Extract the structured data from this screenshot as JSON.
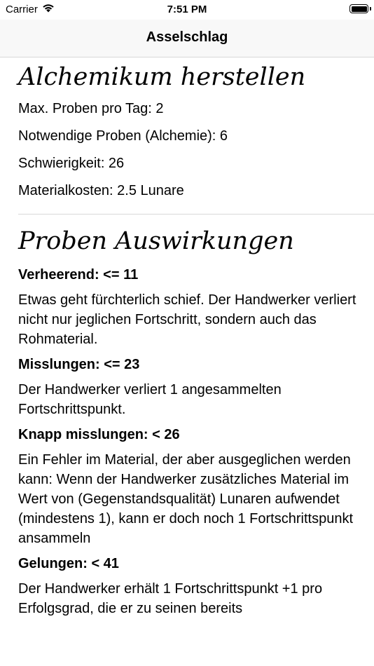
{
  "status_bar": {
    "carrier": "Carrier",
    "time": "7:51 PM"
  },
  "nav": {
    "title": "Asselschlag"
  },
  "crafting": {
    "title": "Alchemikum herstellen",
    "stats": [
      "Max. Proben pro Tag:  2",
      "Notwendige Proben (Alchemie):  6",
      "Schwierigkeit:  26",
      "Materialkosten:  2.5 Lunare"
    ]
  },
  "effects": {
    "title": "Proben Auswirkungen",
    "items": [
      {
        "heading": "Verheerend: <= 11",
        "text": "Etwas geht fürchterlich schief. Der Handwerker verliert nicht nur jeglichen Fortschritt, sondern auch das Rohmaterial."
      },
      {
        "heading": "Misslungen: <= 23",
        "text": "Der Handwerker verliert 1 angesammelten Fortschrittspunkt."
      },
      {
        "heading": "Knapp misslungen: < 26",
        "text": "Ein Fehler im Material, der aber ausgeglichen werden kann: Wenn der Handwerker zusätzliches Material im Wert von (Gegenstandsqualität) Lunaren aufwendet (mindestens 1), kann er doch noch 1 Fortschrittspunkt ansammeln"
      },
      {
        "heading": "Gelungen: < 41",
        "text": "Der Handwerker erhält 1 Fortschrittspunkt +1 pro Erfolgsgrad, die er zu seinen bereits"
      }
    ]
  }
}
